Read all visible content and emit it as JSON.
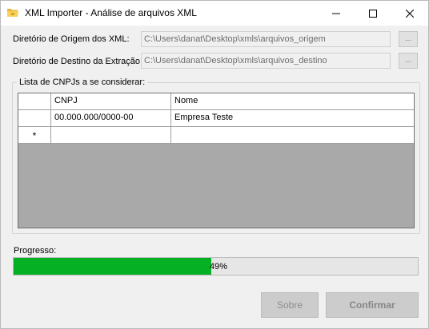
{
  "window": {
    "title": "XML Importer - Análise de arquivos XML",
    "icon": "folder-icon"
  },
  "form": {
    "origin_label": "Diretório de Origem dos XML:",
    "origin_value": "C:\\Users\\danat\\Desktop\\xmls\\arquivos_origem",
    "dest_label": "Diretório de Destino da Extração:",
    "dest_value": "C:\\Users\\danat\\Desktop\\xmls\\arquivos_destino",
    "browse_label": "..."
  },
  "cnpj_group": {
    "legend": "Lista de CNPJs a se considerar:",
    "columns": [
      "CNPJ",
      "Nome"
    ],
    "rows": [
      {
        "cnpj": "00.000.000/0000-00",
        "nome": "Empresa Teste"
      }
    ],
    "new_row_marker": "*"
  },
  "progress": {
    "label": "Progresso:",
    "value": 49,
    "text": "49%",
    "color": "#06b025"
  },
  "buttons": {
    "sobre": "Sobre",
    "confirmar": "Confirmar"
  }
}
